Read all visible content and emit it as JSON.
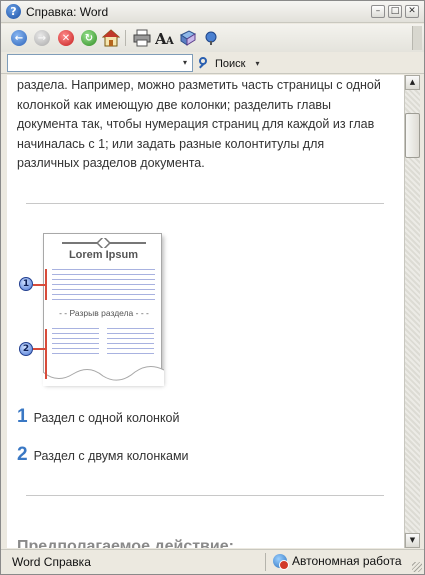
{
  "window": {
    "title": "Справка: Word",
    "help_icon_glyph": "?",
    "minimize_glyph": "–",
    "restore_glyph": "□",
    "close_glyph": "✕"
  },
  "toolbar": {
    "items": [
      {
        "name": "back-button",
        "icon": "back-arrow-icon",
        "glyph": "←"
      },
      {
        "name": "forward-button",
        "icon": "forward-arrow-icon",
        "glyph": "→"
      },
      {
        "name": "stop-button",
        "icon": "stop-icon",
        "glyph": "✕"
      },
      {
        "name": "refresh-button",
        "icon": "refresh-icon",
        "glyph": "↻"
      },
      {
        "name": "home-button",
        "icon": "home-icon",
        "glyph": "⌂"
      },
      {
        "name": "print-button",
        "icon": "printer-icon",
        "glyph": "⎙"
      },
      {
        "name": "font-size-button",
        "icon": "font-size-icon",
        "glyph": "Aᴬ"
      },
      {
        "name": "toc-button",
        "icon": "book-icon",
        "glyph": "📘"
      },
      {
        "name": "keep-on-top-button",
        "icon": "pin-icon",
        "glyph": "●"
      }
    ]
  },
  "search": {
    "value": "",
    "placeholder": "",
    "button_label": "Поиск",
    "dropdown_glyph": "▾"
  },
  "content": {
    "paragraph_lines": [
      "раздела. Например, можно разметить часть страницы с одной",
      "колонкой как имеющую две колонки; разделить главы",
      "документа так, чтобы нумерация страниц для каждой из глав",
      "начиналась с 1; или задать разные колонтитулы для",
      "различных разделов документа."
    ],
    "illustration": {
      "title": "Lorem Ipsum",
      "break_label": "- - Разрыв раздела - - -",
      "callouts": [
        "1",
        "2"
      ]
    },
    "legend": [
      {
        "number": "1",
        "text": "Раздел с одной колонкой"
      },
      {
        "number": "2",
        "text": "Раздел с двумя колонками"
      }
    ],
    "next_heading": "Предполагаемое действие:"
  },
  "scrollbar": {
    "up_glyph": "▲",
    "down_glyph": "▼",
    "position": 0.33
  },
  "statusbar": {
    "left_text": "Word Справка",
    "right_text": "Автономная работа",
    "connection_icon": "globe-offline-icon"
  },
  "colors": {
    "accent_blue": "#3a78c4",
    "marker_red": "#d84b3a",
    "column_line": "#a8b2e0"
  }
}
